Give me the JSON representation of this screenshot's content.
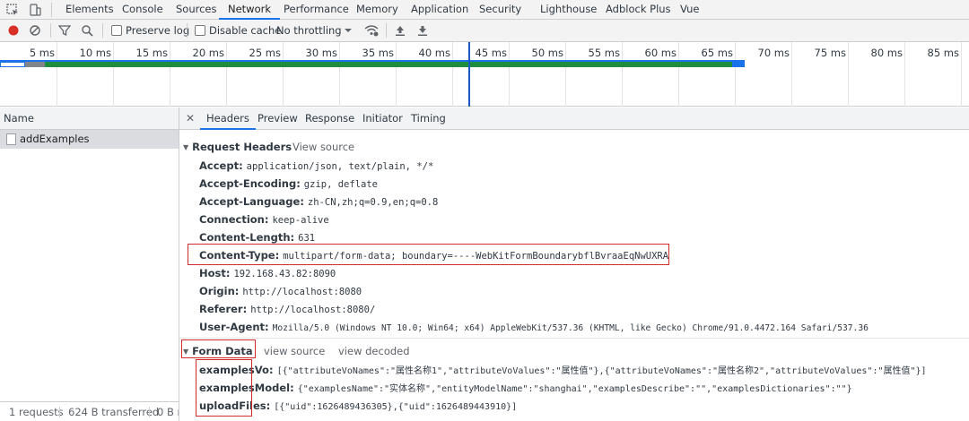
{
  "devtools_tabs": [
    "Elements",
    "Console",
    "Sources",
    "Network",
    "Performance",
    "Memory",
    "Application",
    "Security",
    "Lighthouse",
    "Adblock Plus",
    "Vue"
  ],
  "active_tab": "Network",
  "toolbar": {
    "preserve_log": "Preserve log",
    "disable_cache": "Disable cache",
    "throttling": "No throttling"
  },
  "timeline": {
    "ticks": [
      "5 ms",
      "10 ms",
      "15 ms",
      "20 ms",
      "25 ms",
      "30 ms",
      "35 ms",
      "40 ms",
      "45 ms",
      "50 ms",
      "55 ms",
      "60 ms",
      "65 ms",
      "70 ms",
      "75 ms",
      "80 ms",
      "85 ms"
    ]
  },
  "list": {
    "header": "Name",
    "requests": [
      "addExamples"
    ],
    "status": {
      "requests": "1 requests",
      "transferred": "624 B transferred",
      "resources": "0 B r"
    }
  },
  "detail": {
    "tabs": [
      "Headers",
      "Preview",
      "Response",
      "Initiator",
      "Timing"
    ],
    "active_tab": "Headers",
    "request_headers": {
      "title": "Request Headers",
      "view_source": "View source",
      "rows": [
        {
          "name": "Accept:",
          "value": "application/json, text/plain, */*"
        },
        {
          "name": "Accept-Encoding:",
          "value": "gzip, deflate"
        },
        {
          "name": "Accept-Language:",
          "value": "zh-CN,zh;q=0.9,en;q=0.8"
        },
        {
          "name": "Connection:",
          "value": "keep-alive"
        },
        {
          "name": "Content-Length:",
          "value": "631"
        },
        {
          "name": "Content-Type:",
          "value": "multipart/form-data; boundary=----WebKitFormBoundarybflBvraaEqNwUXRA"
        },
        {
          "name": "Host:",
          "value": "192.168.43.82:8090"
        },
        {
          "name": "Origin:",
          "value": "http://localhost:8080"
        },
        {
          "name": "Referer:",
          "value": "http://localhost:8080/"
        },
        {
          "name": "User-Agent:",
          "value": "Mozilla/5.0 (Windows NT 10.0; Win64; x64) AppleWebKit/537.36 (KHTML, like Gecko) Chrome/91.0.4472.164 Safari/537.36"
        }
      ]
    },
    "form_data": {
      "title": "Form Data",
      "view_source": "view source",
      "view_decoded": "view decoded",
      "rows": [
        {
          "name": "examplesVo:",
          "value": "[{\"attributeVoNames\":\"属性名称1\",\"attributeVoValues\":\"属性值\"},{\"attributeVoNames\":\"属性名称2\",\"attributeVoValues\":\"属性值\"}]"
        },
        {
          "name": "examplesModel:",
          "value": "{\"examplesName\":\"实体名称\",\"entityModelName\":\"shanghai\",\"examplesDescribe\":\"\",\"examplesDictionaries\":\"\"}"
        },
        {
          "name": "uploadFiles:",
          "value": "[{\"uid\":1626489436305},{\"uid\":1626489443910}]"
        }
      ]
    }
  },
  "colors": {
    "accent": "#1a73e8",
    "record": "#d93025",
    "highlight_box": "#d32a2a",
    "timeline_green": "#1e8e3e",
    "timeline_blue": "#1a73e8"
  }
}
